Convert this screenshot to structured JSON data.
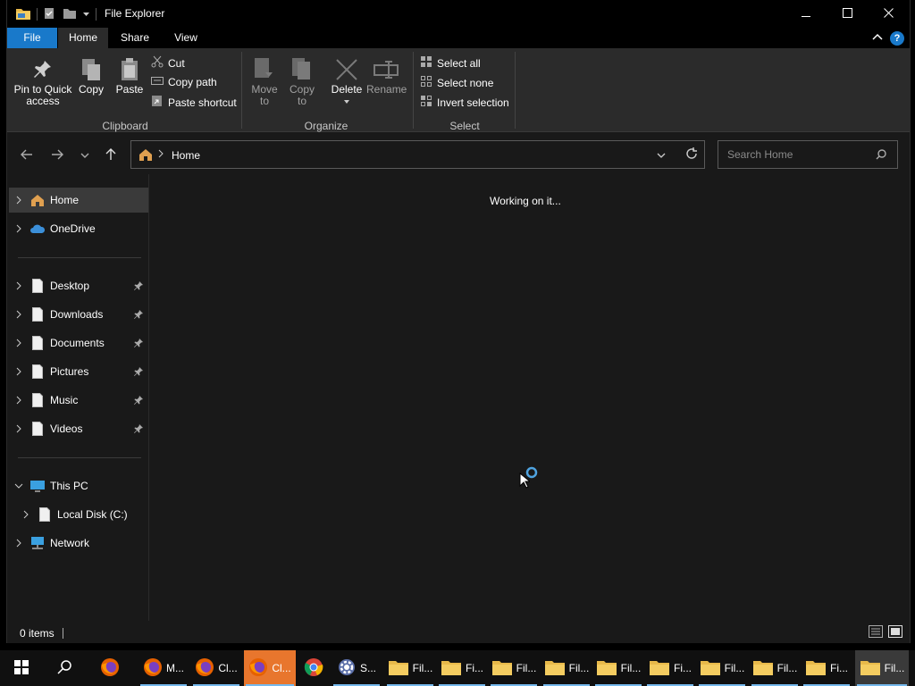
{
  "window": {
    "title": "File Explorer",
    "minimize_icon": "minimize-icon",
    "maximize_icon": "maximize-icon",
    "close_icon": "close-icon"
  },
  "ribbon_tabs": {
    "file": "File",
    "home": "Home",
    "share": "Share",
    "view": "View"
  },
  "ribbon": {
    "clipboard": {
      "pin_line1": "Pin to Quick",
      "pin_line2": "access",
      "copy": "Copy",
      "paste": "Paste",
      "cut": "Cut",
      "copy_path": "Copy path",
      "paste_shortcut": "Paste shortcut",
      "group_label": "Clipboard"
    },
    "organize": {
      "move_line1": "Move",
      "move_line2": "to",
      "copy_line1": "Copy",
      "copy_line2": "to",
      "delete": "Delete",
      "rename": "Rename",
      "group_label": "Organize"
    },
    "select": {
      "select_all": "Select all",
      "select_none": "Select none",
      "invert_selection": "Invert selection",
      "group_label": "Select"
    }
  },
  "address": {
    "location": "Home",
    "search_placeholder": "Search Home"
  },
  "nav": {
    "home": "Home",
    "onedrive": "OneDrive",
    "desktop": "Desktop",
    "downloads": "Downloads",
    "documents": "Documents",
    "pictures": "Pictures",
    "music": "Music",
    "videos": "Videos",
    "this_pc": "This PC",
    "local_disk": "Local Disk (C:)",
    "network": "Network"
  },
  "content": {
    "message": "Working on it..."
  },
  "status": {
    "items": "0 items"
  },
  "taskbar": {
    "items": [
      {
        "icon": "firefox-icon",
        "label": ""
      },
      {
        "icon": "firefox-icon",
        "label": "M..."
      },
      {
        "icon": "firefox-icon",
        "label": "Cl..."
      },
      {
        "icon": "firefox-icon",
        "label": "Cl..."
      },
      {
        "icon": "chrome-icon",
        "label": ""
      },
      {
        "icon": "settings-gear-icon",
        "label": "S..."
      },
      {
        "icon": "folder-icon",
        "label": "Fil..."
      },
      {
        "icon": "folder-icon",
        "label": "Fi..."
      },
      {
        "icon": "folder-icon",
        "label": "Fil..."
      },
      {
        "icon": "folder-icon",
        "label": "Fil..."
      },
      {
        "icon": "folder-icon",
        "label": "Fil..."
      },
      {
        "icon": "folder-icon",
        "label": "Fi..."
      },
      {
        "icon": "folder-icon",
        "label": "Fil..."
      },
      {
        "icon": "folder-icon",
        "label": "Fil..."
      },
      {
        "icon": "folder-icon",
        "label": "Fi..."
      },
      {
        "icon": "folder-icon",
        "label": "Fil..."
      }
    ]
  },
  "colors": {
    "file_tab": "#1979ca",
    "background": "#191919",
    "ribbon": "#2b2b2b",
    "accent": "#4fa3e0"
  }
}
